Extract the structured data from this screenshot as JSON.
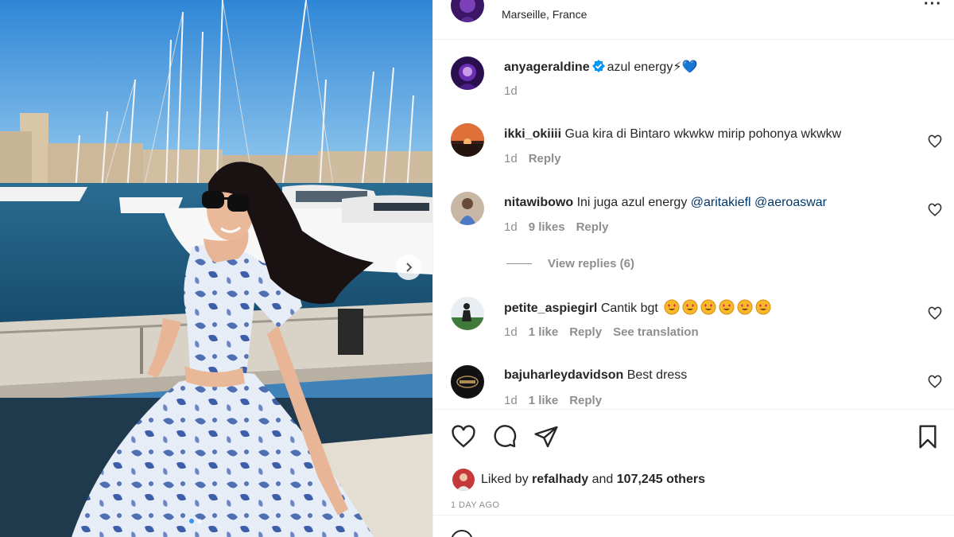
{
  "post": {
    "author": "anyageraldine",
    "location": "Marseille, France",
    "caption": "azul energy⚡💙",
    "caption_age": "1d",
    "accent_color": "#0095f6"
  },
  "comments": [
    {
      "user": "ikki_okiiii",
      "text": "Gua kira di Bintaro wkwkw mirip pohonya wkwkw",
      "age": "1d",
      "likes": "",
      "reply": "Reply",
      "translate": ""
    },
    {
      "user": "nitawibowo",
      "text": "Ini juga azul energy ",
      "mentions": [
        "@aritakiefl",
        "@aeroaswar"
      ],
      "age": "1d",
      "likes": "9 likes",
      "reply": "Reply",
      "translate": ""
    },
    {
      "user": "petite_aspiegirl",
      "text": "Cantik bgt",
      "age": "1d",
      "likes": "1 like",
      "reply": "Reply",
      "translate": "See translation"
    },
    {
      "user": "bajuharleydavidson",
      "text": "Best dress",
      "age": "1d",
      "likes": "1 like",
      "reply": "Reply",
      "translate": ""
    }
  ],
  "view_replies": "View replies (6)",
  "likes": {
    "prefix": "Liked by ",
    "user": "refalhady",
    "middle": " and ",
    "count": "107,245 others"
  },
  "date": "1 DAY AGO",
  "icons": [
    "like-icon",
    "comment-icon",
    "share-icon",
    "save-icon",
    "verified-icon",
    "more-icon",
    "carousel-next-icon"
  ]
}
